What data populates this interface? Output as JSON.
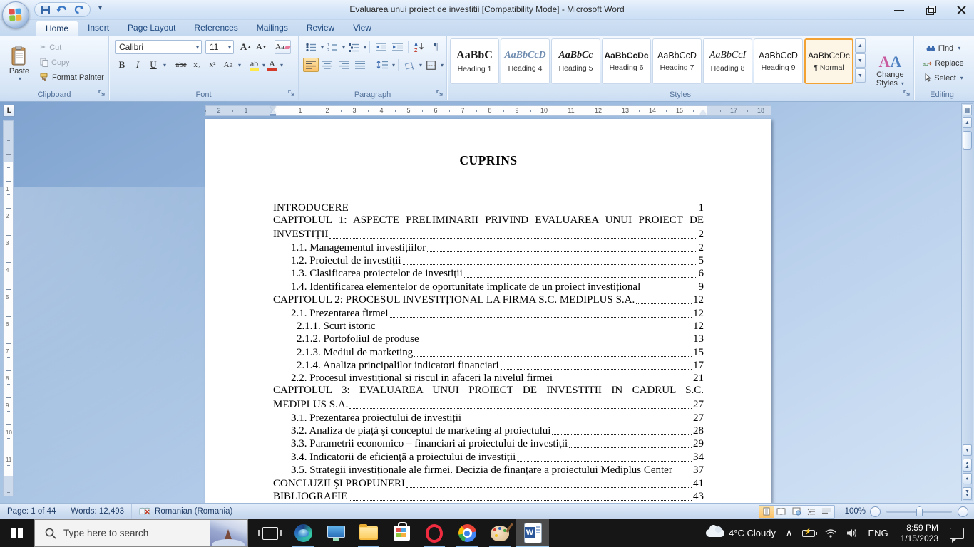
{
  "window": {
    "title": "Evaluarea unui proiect de investitii [Compatibility Mode] - Microsoft Word"
  },
  "ribbon": {
    "tabs": [
      "Home",
      "Insert",
      "Page Layout",
      "References",
      "Mailings",
      "Review",
      "View"
    ],
    "active_tab": "Home",
    "clipboard": {
      "label": "Clipboard",
      "paste": "Paste",
      "cut": "Cut",
      "copy": "Copy",
      "format_painter": "Format Painter"
    },
    "font": {
      "label": "Font",
      "font_name": "Calibri",
      "font_size": "11"
    },
    "paragraph": {
      "label": "Paragraph"
    },
    "styles": {
      "label": "Styles",
      "items": [
        {
          "sample": "AaBbC",
          "name": "Heading 1",
          "variant": "h1",
          "selected": false
        },
        {
          "sample": "AaBbCcD",
          "name": "Heading 4",
          "variant": "h4",
          "selected": false
        },
        {
          "sample": "AaBbCc",
          "name": "Heading 5",
          "variant": "h5",
          "selected": false
        },
        {
          "sample": "AaBbCcDc",
          "name": "Heading 6",
          "variant": "h6",
          "selected": false
        },
        {
          "sample": "AaBbCcD",
          "name": "Heading 7",
          "variant": "h7",
          "selected": false
        },
        {
          "sample": "AaBbCcI",
          "name": "Heading 8",
          "variant": "h8",
          "selected": false
        },
        {
          "sample": "AaBbCcD",
          "name": "Heading 9",
          "variant": "h9",
          "selected": false
        },
        {
          "sample": "AaBbCcDc",
          "name": "¶ Normal",
          "variant": "normal",
          "selected": true
        }
      ],
      "change_styles": "Change Styles"
    },
    "editing": {
      "label": "Editing",
      "find": "Find",
      "replace": "Replace",
      "select": "Select"
    }
  },
  "ruler": {
    "left_labels": [
      "2",
      "1"
    ],
    "white_labels": [
      "1",
      "2",
      "3",
      "4",
      "5",
      "6",
      "7",
      "8",
      "9",
      "10",
      "11",
      "12",
      "13",
      "14",
      "15"
    ],
    "right_labels": [
      "17",
      "18"
    ]
  },
  "document": {
    "title": "CUPRINS",
    "toc": [
      {
        "text": "INTRODUCERE",
        "page": "1",
        "indent": 0
      },
      {
        "pre": "CAPITOLUL 1: ASPECTE PRELIMINARII PRIVIND EVALUAREA UNUI PROIECT DE",
        "text": "INVESTIȚII",
        "page": "2",
        "indent": 0
      },
      {
        "text": "1.1. Managementul investițiilor",
        "page": "2",
        "indent": 1
      },
      {
        "text": "1.2. Proiectul de investiții",
        "page": "5",
        "indent": 1
      },
      {
        "text": "1.3. Clasificarea proiectelor de investiții",
        "page": "6",
        "indent": 1
      },
      {
        "text": "1.4. Identificarea elementelor de oportunitate implicate de un proiect investițional",
        "page": "9",
        "indent": 1
      },
      {
        "text": "CAPITOLUL 2: PROCESUL INVESTIȚIONAL LA FIRMA S.C. MEDIPLUS S.A.",
        "page": "12",
        "indent": 0
      },
      {
        "text": "2.1. Prezentarea firmei",
        "page": "12",
        "indent": 1
      },
      {
        "text": "2.1.1. Scurt istoric",
        "page": "12",
        "indent": 2
      },
      {
        "text": "2.1.2. Portofoliul de produse",
        "page": "13",
        "indent": 2
      },
      {
        "text": "2.1.3. Mediul de marketing",
        "page": "15",
        "indent": 2
      },
      {
        "text": "2.1.4. Analiza principalilor indicatori financiari",
        "page": "17",
        "indent": 2
      },
      {
        "text": "2.2. Procesul investițional si riscul in afaceri la nivelul firmei",
        "page": "21",
        "indent": 1
      },
      {
        "pre": "CAPITOLUL 3: EVALUAREA UNUI PROIECT DE INVESTITII IN CADRUL S.C.",
        "text": "MEDIPLUS S.A.",
        "page": "27",
        "indent": 0
      },
      {
        "text": "3.1. Prezentarea proiectului de investiții",
        "page": "27",
        "indent": 1
      },
      {
        "text": "3.2. Analiza de piață şi conceptul de marketing al proiectului",
        "page": "28",
        "indent": 1
      },
      {
        "text": "3.3. Parametrii economico – financiari ai proiectului de investiții",
        "page": "29",
        "indent": 1
      },
      {
        "text": "3.4. Indicatorii de eficiență a proiectului de investiții",
        "page": "34",
        "indent": 1
      },
      {
        "text": "3.5. Strategii investiționale ale firmei. Decizia de finanțare a proiectului Mediplus Center",
        "page": "37",
        "indent": 1
      },
      {
        "text": "CONCLUZII ŞI PROPUNERI",
        "page": "41",
        "indent": 0
      },
      {
        "text": "BIBLIOGRAFIE",
        "page": "43",
        "indent": 0
      }
    ]
  },
  "status_bar": {
    "page": "Page: 1 of 44",
    "words": "Words: 12,493",
    "language": "Romanian (Romania)",
    "zoom": "100%"
  },
  "taskbar": {
    "search_placeholder": "Type here to search",
    "tray": {
      "weather": "4°C Cloudy",
      "language": "ENG",
      "time": "8:59 PM",
      "date": "1/15/2023"
    }
  },
  "colors": {
    "selection_orange": "#f2a233",
    "chrome_blue": "#d8e7f8",
    "word_blue": "#2b579a",
    "taskbar_black": "#161616"
  }
}
